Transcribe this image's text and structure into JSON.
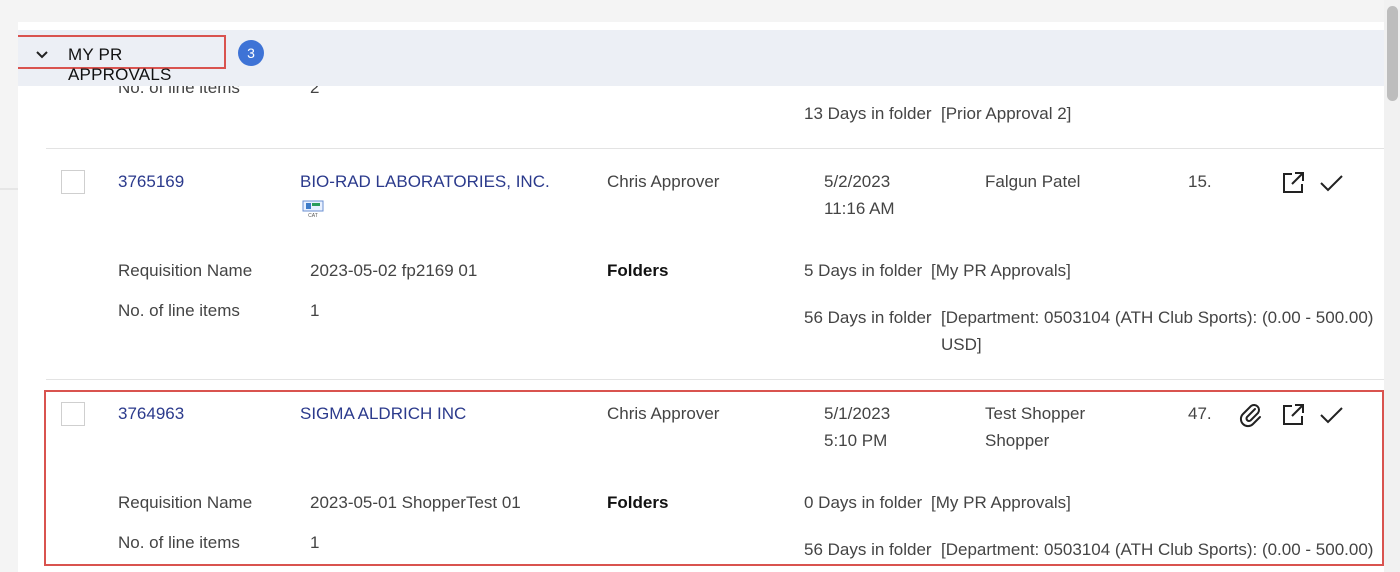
{
  "section": {
    "title": "MY PR APPROVALS",
    "count": "3"
  },
  "prev_row": {
    "line_items_label": "No. of line items",
    "line_items_value": "2",
    "folder_days": "13 Days in folder",
    "folder_name": "[Prior Approval 2]"
  },
  "rows": [
    {
      "id": "3765169",
      "supplier": "BIO-RAD LABORATORIES, INC.",
      "supplier_badge": "punchout-catalog-icon",
      "approver": "Chris Approver",
      "date": "5/2/2023",
      "time": "11:16 AM",
      "requester": "Falgun Patel",
      "requester_line2": "",
      "amount": "15.",
      "req_name_label": "Requisition Name",
      "req_name": "2023-05-02 fp2169 01",
      "folders_label": "Folders",
      "line_items_label": "No. of line items",
      "line_items": "1",
      "folders": [
        {
          "days": "5 Days in folder",
          "name": "[My PR Approvals]"
        },
        {
          "days": "56 Days in folder",
          "name": "[Department: 0503104 (ATH Club Sports): (0.00 - 500.00)",
          "name_cont": "USD]"
        }
      ],
      "icons": [
        "open-external-icon",
        "approve-check-icon"
      ]
    },
    {
      "id": "3764963",
      "supplier": "SIGMA ALDRICH INC",
      "approver": "Chris Approver",
      "date": "5/1/2023",
      "time": "5:10 PM",
      "requester": "Test Shopper",
      "requester_line2": "Shopper",
      "amount": "47.",
      "req_name_label": "Requisition Name",
      "req_name": "2023-05-01 ShopperTest 01",
      "folders_label": "Folders",
      "line_items_label": "No. of line items",
      "line_items": "1",
      "folders": [
        {
          "days": "0 Days in folder",
          "name": "[My PR Approvals]"
        },
        {
          "days": "56 Days in folder",
          "name": "[Department: 0503104 (ATH Club Sports): (0.00 - 500.00)"
        }
      ],
      "icons": [
        "attachment-paperclip-icon",
        "open-external-icon",
        "approve-check-icon"
      ]
    }
  ],
  "colors": {
    "link": "#2b3a8c",
    "badge": "#3e73d6",
    "highlight_border": "#d9534f",
    "header_bg": "#eceff5"
  }
}
